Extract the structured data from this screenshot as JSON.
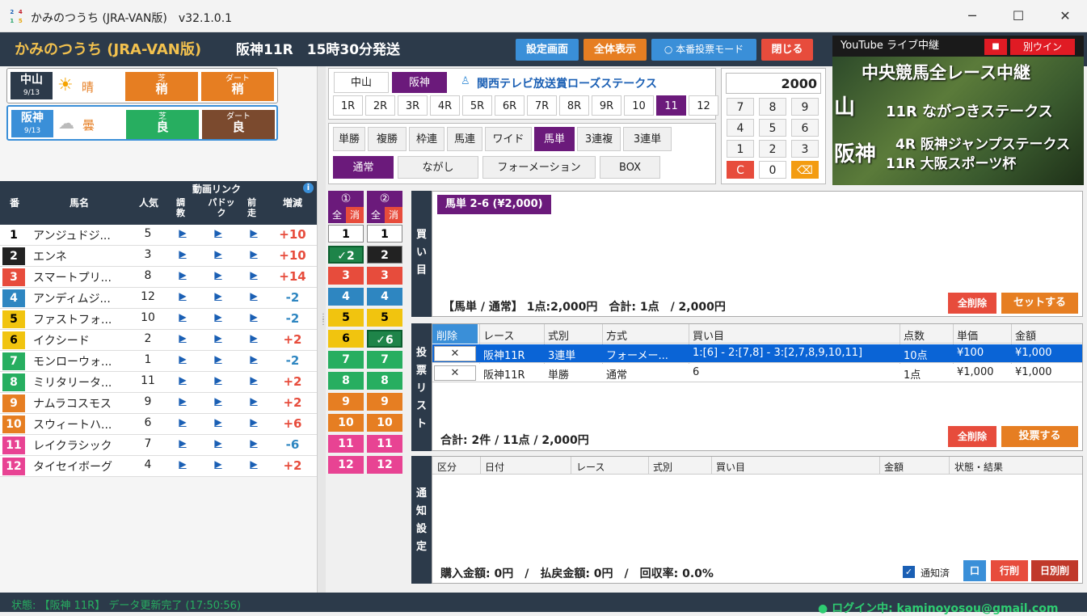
{
  "window": {
    "title": "かみのつうち (JRA-VAN版)　v32.1.0.1",
    "icon_digits": [
      "2",
      "4",
      "1",
      "5"
    ],
    "min": "─",
    "max": "☐",
    "close": "✕"
  },
  "header": {
    "app_title": "かみのつうち (JRA-VAN版)",
    "race_info": "阪神11R　15時30分発送",
    "buttons": {
      "settings": "設定画面",
      "show_all": "全体表示",
      "real_vote_mode": "○ 本番投票モード",
      "close": "閉じる"
    }
  },
  "youtube": {
    "header": "YouTube ライブ中継",
    "stop": "■",
    "separate_window": "別ウイン",
    "lines": [
      "中央競馬全レース中継",
      "山",
      "11R ながつきステークス",
      "阪神",
      "4R 阪神ジャンプステークス",
      "11R 大阪スポーツ杯"
    ]
  },
  "venues": [
    {
      "name": "中山",
      "date": "9/13",
      "weather_icon": "sun",
      "weather": "晴",
      "turf_label": "芝",
      "turf": "稍",
      "dirt_label": "ダート",
      "dirt": "稍"
    },
    {
      "name": "阪神",
      "date": "9/13",
      "weather_icon": "cloud",
      "weather": "曇",
      "turf_label": "芝",
      "turf": "良",
      "dirt_label": "ダート",
      "dirt": "良"
    }
  ],
  "horse_table": {
    "headers": {
      "num": "番",
      "name": "馬名",
      "pop": "人気",
      "video": "動画リンク",
      "training": "調教",
      "paddock": "パドック",
      "pre": "前走",
      "change": "増減"
    },
    "play": "▶",
    "rows": [
      {
        "num": "1",
        "name": "アンジュドジ...",
        "pop": "5",
        "change": "+10"
      },
      {
        "num": "2",
        "name": "エンネ",
        "pop": "3",
        "change": "+10"
      },
      {
        "num": "3",
        "name": "スマートプリ...",
        "pop": "8",
        "change": "+14"
      },
      {
        "num": "4",
        "name": "アンディムジ...",
        "pop": "12",
        "change": "-2"
      },
      {
        "num": "5",
        "name": "ファストフォ...",
        "pop": "10",
        "change": "-2"
      },
      {
        "num": "6",
        "name": "イクシード",
        "pop": "2",
        "change": "+2"
      },
      {
        "num": "7",
        "name": "モンローウォ...",
        "pop": "1",
        "change": "-2"
      },
      {
        "num": "8",
        "name": "ミリタリータ...",
        "pop": "11",
        "change": "+2"
      },
      {
        "num": "9",
        "name": "ナムラコスモス",
        "pop": "9",
        "change": "+2"
      },
      {
        "num": "10",
        "name": "スウィートハ...",
        "pop": "6",
        "change": "+6"
      },
      {
        "num": "11",
        "name": "レイクラシック",
        "pop": "7",
        "change": "-6"
      },
      {
        "num": "12",
        "name": "タイセイボーグ",
        "pop": "4",
        "change": "+2"
      }
    ]
  },
  "race_select": {
    "venues": [
      "中山",
      "阪神"
    ],
    "selected_venue": "阪神",
    "race_name": "関西テレビ放送賞ローズステークス",
    "races": [
      "1R",
      "2R",
      "3R",
      "4R",
      "5R",
      "6R",
      "7R",
      "8R",
      "9R",
      "10",
      "11",
      "12"
    ],
    "selected_race": "11"
  },
  "bet_types": [
    "単勝",
    "複勝",
    "枠連",
    "馬連",
    "ワイド",
    "馬単",
    "3連複",
    "3連単"
  ],
  "selected_bet": "馬単",
  "methods": [
    "通常",
    "ながし",
    "フォーメーション",
    "BOX"
  ],
  "selected_method": "通常",
  "keypad": {
    "display": "2000",
    "keys": [
      "7",
      "8",
      "9",
      "4",
      "5",
      "6",
      "1",
      "2",
      "3",
      "C",
      "0",
      "⌫"
    ]
  },
  "picks": {
    "col1": "①",
    "col2": "②",
    "all": "全",
    "clear": "消",
    "col1_items": [
      "1",
      "✓2",
      "3",
      "4",
      "5",
      "6",
      "7",
      "8",
      "9",
      "10",
      "11",
      "12"
    ],
    "col2_items": [
      "1",
      "2",
      "3",
      "4",
      "5",
      "✓6",
      "7",
      "8",
      "9",
      "10",
      "11",
      "12"
    ]
  },
  "kaime": {
    "label": "買い目",
    "tag": "馬単 2-6 (¥2,000)",
    "summary": "【馬単 / 通常】 1点:2,000円　合計: 1点　/ 2,000円",
    "clear": "全削除",
    "set": "セットする"
  },
  "vote_list": {
    "label": "投票リスト",
    "headers": [
      "削除",
      "レース",
      "式別",
      "方式",
      "買い目",
      "点数",
      "単価",
      "金額"
    ],
    "rows": [
      {
        "del": "✕",
        "race": "阪神11R",
        "type": "3連単",
        "method": "フォーメー...",
        "kaime": "1:[6] - 2:[7,8] - 3:[2,7,8,9,10,11]",
        "points": "10点",
        "unit": "¥100",
        "amount": "¥1,000"
      },
      {
        "del": "✕",
        "race": "阪神11R",
        "type": "単勝",
        "method": "通常",
        "kaime": "6",
        "points": "1点",
        "unit": "¥1,000",
        "amount": "¥1,000"
      }
    ],
    "total": "合計: 2件 / 11点 / 2,000円",
    "clear": "全削除",
    "vote": "投票する"
  },
  "notify": {
    "label": "通知設定",
    "headers": [
      "区分",
      "日付",
      "レース",
      "式別",
      "買い目",
      "金額",
      "状態・結果"
    ],
    "summary": "購入金額: 0円　/　払戻金額: 0円　/　回収率: 0.0%",
    "notified": "通知済",
    "btn_o": "口",
    "row_del": "行削",
    "day_del": "日別削"
  },
  "status": {
    "text": "状態: 【阪神 11R】 データ更新完了 (17:50:56)",
    "login": "● ログイン中: kaminoyosou@gmail.com"
  }
}
